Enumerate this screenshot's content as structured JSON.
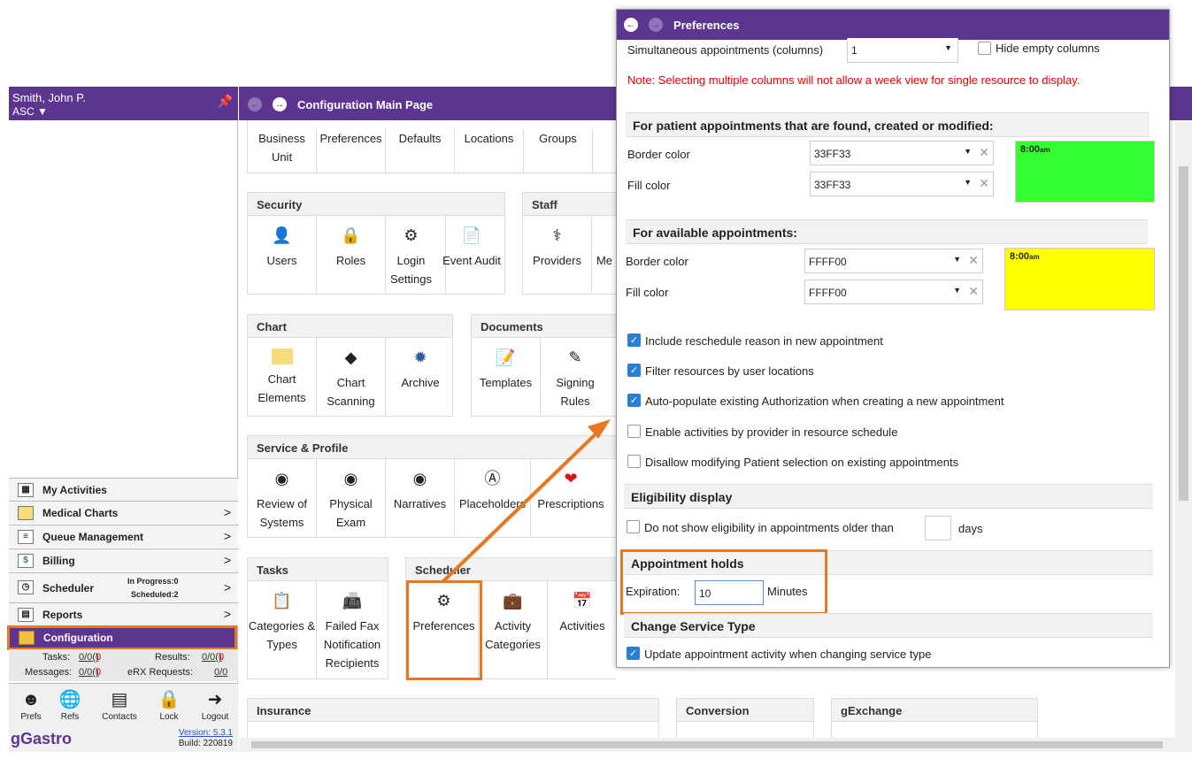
{
  "sidebar": {
    "user": "Smith, John P.",
    "org": "ASC",
    "menus": [
      {
        "label": "My Activities",
        "icon": "calendar-icon"
      },
      {
        "label": "Medical Charts",
        "icon": "folder-icon"
      },
      {
        "label": "Queue Management",
        "icon": "list-icon"
      },
      {
        "label": "Billing",
        "icon": "dollar-icon"
      },
      {
        "label": "Scheduler",
        "icon": "clock-icon"
      },
      {
        "label": "Reports",
        "icon": "report-icon"
      },
      {
        "label": "Configuration",
        "icon": "config-icon"
      }
    ],
    "scheduler_in_progress": "In Progress:0",
    "scheduler_scheduled": "Scheduled:2",
    "counts": {
      "tasks_label": "Tasks:",
      "tasks_value": "0/0",
      "tasks_red": "0",
      "results_label": "Results:",
      "results_value": "0/0",
      "results_red": "0",
      "messages_label": "Messages:",
      "messages_value": "0/0",
      "messages_red": "0",
      "erx_label": "eRX Requests:",
      "erx_value": "0/0"
    },
    "bottom_buttons": [
      "Prefs",
      "Refs",
      "Contacts",
      "Lock",
      "Logout"
    ],
    "brand": "gGastro",
    "version": "Version: 5.3.1",
    "build": "Build: 220819"
  },
  "main": {
    "title": "Configuration Main Page",
    "top_row": [
      "Business Unit",
      "Preferences",
      "Defaults",
      "Locations",
      "Groups"
    ],
    "groups": {
      "security": {
        "title": "Security",
        "tiles": [
          "Users",
          "Roles",
          "Login Settings",
          "Event Audit"
        ]
      },
      "staff": {
        "title": "Staff",
        "tiles": [
          "Providers",
          "Me"
        ]
      },
      "chart": {
        "title": "Chart",
        "tiles": [
          "Chart Elements",
          "Chart Scanning",
          "Archive"
        ]
      },
      "documents": {
        "title": "Documents",
        "tiles": [
          "Templates",
          "Signing Rules"
        ]
      },
      "service": {
        "title": "Service & Profile",
        "tiles": [
          "Review of Systems",
          "Physical Exam",
          "Narratives",
          "Placeholders",
          "Prescriptions"
        ]
      },
      "tasks": {
        "title": "Tasks",
        "tiles": [
          "Categories & Types",
          "Failed Fax Notification Recipients"
        ]
      },
      "scheduler": {
        "title": "Scheduler",
        "tiles": [
          "Preferences",
          "Activity Categories",
          "Activities"
        ]
      },
      "insurance": {
        "title": "Insurance"
      },
      "conversion": {
        "title": "Conversion"
      },
      "gexchange": {
        "title": "gExchange"
      }
    }
  },
  "dialog": {
    "title": "Preferences",
    "simultaneous_label": "Simultaneous appointments (columns)",
    "simultaneous_value": "1",
    "hide_empty_label": "Hide empty columns",
    "note": "Note: Selecting multiple columns will not allow a week view for single resource to display.",
    "patient_section": "For patient appointments that are found, created or modified:",
    "patient_border_label": "Border color",
    "patient_border_value": "33FF33",
    "patient_fill_label": "Fill color",
    "patient_fill_value": "33FF33",
    "patient_swatch_time": "8:00",
    "patient_swatch_suffix": "am",
    "patient_color": "#33FF33",
    "available_section": "For available appointments:",
    "available_border_label": "Border color",
    "available_border_value": "FFFF00",
    "available_fill_label": "Fill color",
    "available_fill_value": "FFFF00",
    "available_swatch_time": "8:00",
    "available_swatch_suffix": "am",
    "available_color": "#FFFF00",
    "checkboxes": [
      {
        "label": "Include reschedule reason in new appointment",
        "checked": true
      },
      {
        "label": "Filter resources by user locations",
        "checked": true
      },
      {
        "label": "Auto-populate existing Authorization when creating a new appointment",
        "checked": true
      },
      {
        "label": "Enable activities by provider in resource schedule",
        "checked": false
      },
      {
        "label": "Disallow modifying Patient selection on existing appointments",
        "checked": false
      }
    ],
    "eligibility_section": "Eligibility display",
    "eligibility_label": "Do not show eligibility in appointments older than",
    "eligibility_days": "days",
    "holds_section": "Appointment holds",
    "expiration_label": "Expiration:",
    "expiration_value": "10",
    "minutes_label": "Minutes",
    "service_type_section": "Change Service Type",
    "service_type_label": "Update appointment activity when changing service type"
  },
  "colors": {
    "brand": "#5b3590",
    "highlight": "#e87722",
    "note": "#e60000",
    "check": "#2a7fd4"
  }
}
